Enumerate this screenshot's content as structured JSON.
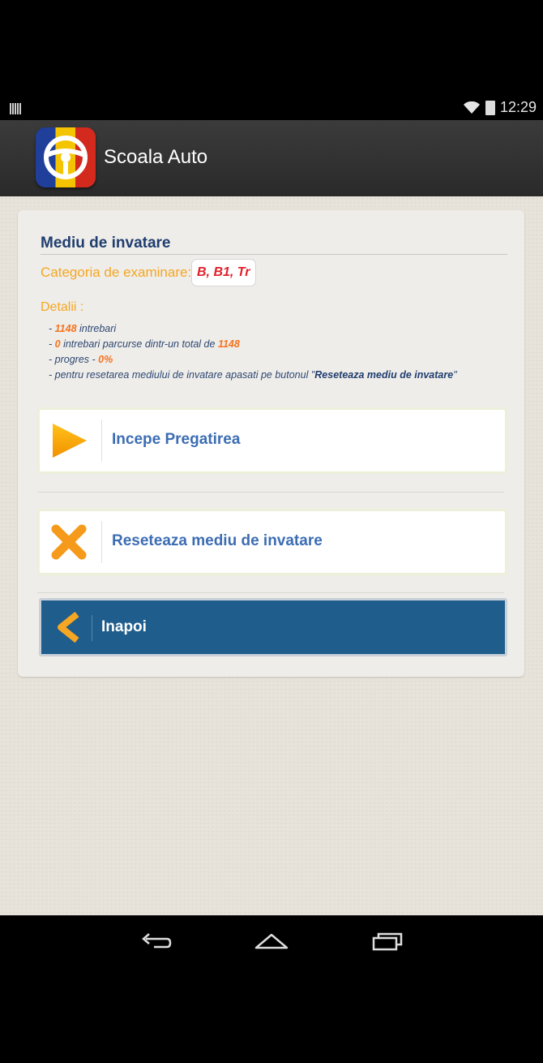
{
  "status_bar": {
    "time": "12:29"
  },
  "action_bar": {
    "title": "Scoala Auto",
    "app_icon": "steering-wheel-icon"
  },
  "card": {
    "title": "Mediu de invatare",
    "category_label": "Categoria de examinare:",
    "category_value": "B, B1, Tr",
    "details_label": "Detalii :",
    "details": {
      "questions_count": "1148",
      "questions_text": "intrebari",
      "covered_count": "0",
      "covered_text": "intrebari parcurse dintr-un total de",
      "total_count": "1148",
      "progress_text": "progres -",
      "progress_value": "0%",
      "reset_text": "pentru resetarea mediului de invatare apasati pe butonul",
      "reset_button_ref": "Reseteaza mediu de invatare"
    },
    "start_button": {
      "label": "Incepe Pregatirea",
      "icon": "play-icon"
    },
    "reset_button": {
      "label": "Reseteaza mediu de invatare",
      "icon": "close-x-icon"
    },
    "back_button": {
      "label": "Inapoi",
      "icon": "chevron-left-icon"
    }
  },
  "nav_bar": {
    "icons": [
      "back-icon",
      "home-icon",
      "recents-icon"
    ]
  },
  "colors": {
    "accent_orange": "#f5a623",
    "title_blue": "#1f3d6f",
    "button_blue": "#1f5d8c",
    "badge_red": "#e11f2a"
  }
}
